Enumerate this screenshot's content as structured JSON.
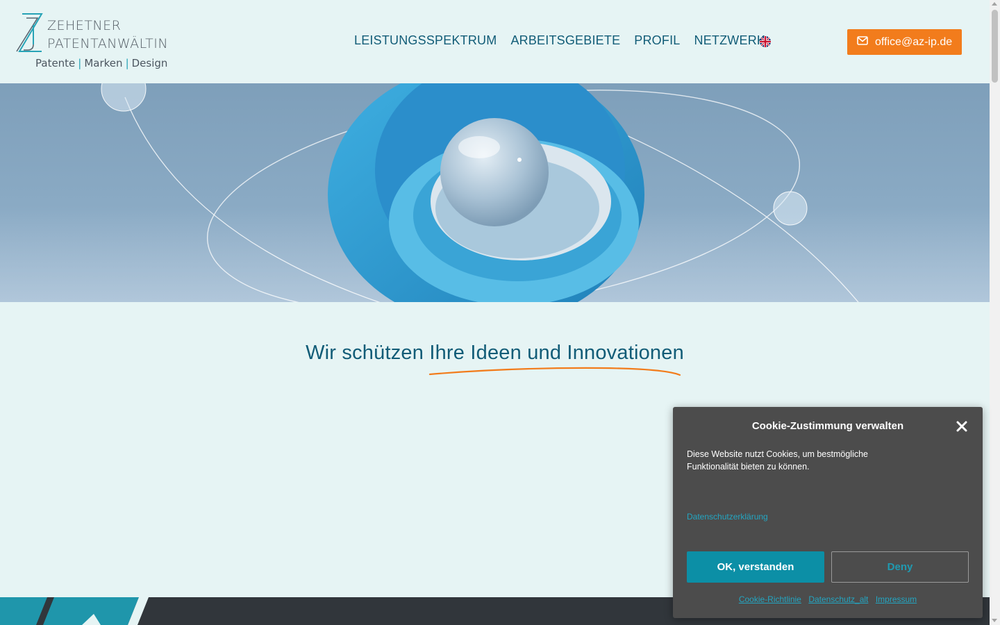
{
  "brand": {
    "name_line1": "Zehetner",
    "name_line2": "Patentanwältin",
    "tagline": [
      "Patente",
      "Marken",
      "Design"
    ]
  },
  "nav": {
    "items": [
      {
        "label": "LEISTUNGSSPEKTRUM"
      },
      {
        "label": "ARBEITSGEBIETE"
      },
      {
        "label": "PROFIL"
      },
      {
        "label": "NETZWERK"
      }
    ],
    "language_flag": "uk-flag-icon"
  },
  "contact_button": {
    "icon": "envelope-icon",
    "label": "office@az-ip.de"
  },
  "headline": {
    "text": "Wir schützen Ihre Ideen und Innovationen"
  },
  "cookie_dialog": {
    "title": "Cookie-Zustimmung verwalten",
    "description": "Diese Website nutzt Cookies, um bestmögliche Funktionalität bieten zu können.",
    "privacy_link": "Datenschutzerklärung",
    "accept_label": "OK, verstanden",
    "deny_label": "Deny",
    "footer_links": [
      "Cookie-Richtlinie",
      "Datenschutz_alt",
      "Impressum"
    ]
  },
  "colors": {
    "background": "#e6f4f4",
    "nav_text": "#115c77",
    "accent_orange": "#f27c1c",
    "cookie_bg": "#4c4c4c",
    "cookie_primary": "#0c8fa6",
    "link": "#23a6c2",
    "footer": "#31363b"
  }
}
